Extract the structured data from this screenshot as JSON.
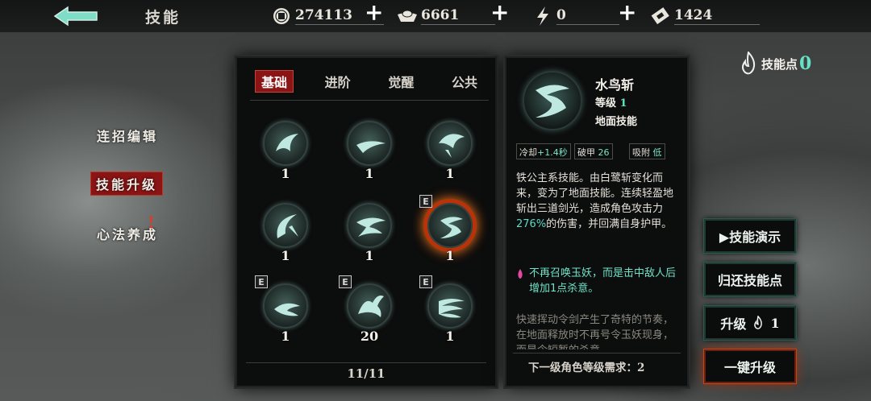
{
  "header": {
    "title": "技能",
    "resources": [
      {
        "icon": "coin-icon",
        "value": "274113"
      },
      {
        "icon": "ingot-icon",
        "value": "6661"
      },
      {
        "icon": "energy-icon",
        "value": "0"
      },
      {
        "icon": "ticket-icon",
        "value": "1424"
      }
    ],
    "plus_label": "+"
  },
  "sidebar": {
    "items": [
      {
        "label": "连招编辑"
      },
      {
        "label": "技能升级"
      },
      {
        "label": "心法养成"
      }
    ],
    "alert": "!"
  },
  "skills_panel": {
    "tabs": [
      "基础",
      "进阶",
      "觉醒",
      "公共"
    ],
    "active_tab": "基础",
    "grid": [
      {
        "level": "1",
        "badge": ""
      },
      {
        "level": "1",
        "badge": ""
      },
      {
        "level": "1",
        "badge": ""
      },
      {
        "level": "1",
        "badge": ""
      },
      {
        "level": "1",
        "badge": ""
      },
      {
        "level": "1",
        "badge": "E"
      },
      {
        "level": "1",
        "badge": "E"
      },
      {
        "level": "20",
        "badge": "E"
      },
      {
        "level": "1",
        "badge": "E"
      }
    ],
    "selected_index": 5,
    "page": "11/11"
  },
  "detail": {
    "name": "水鸟斩",
    "level_label": "等级",
    "level_value": "1",
    "type": "地面技能",
    "stats": [
      {
        "key": "冷却",
        "value": "+1.4秒"
      },
      {
        "key": "破甲",
        "value": "26"
      },
      {
        "key": "吸附",
        "value": "低"
      }
    ],
    "description_before": "铁公主系技能。由白鹭斩变化而来，变为了地面技能。连续轻盈地斩出三道剑光，造成角色攻击力",
    "description_pct": "276%",
    "description_after": "的伤害，并回满自身护甲。",
    "effect": "不再召唤玉妖，而是击中敌人后增加1点杀意。",
    "flavor": "快速挥动令剑产生了奇特的节奏，在地面释放时不再号令玉妖现身，而是令短暂的杀意",
    "next_requirement": "下一级角色等级需求：2"
  },
  "skill_points": {
    "label": "技能点",
    "value": "0"
  },
  "buttons": {
    "demo": "▶技能演示",
    "refund": "归还技能点",
    "upgrade_label": "升级",
    "upgrade_cost": "1",
    "one_click": "一键升级"
  }
}
